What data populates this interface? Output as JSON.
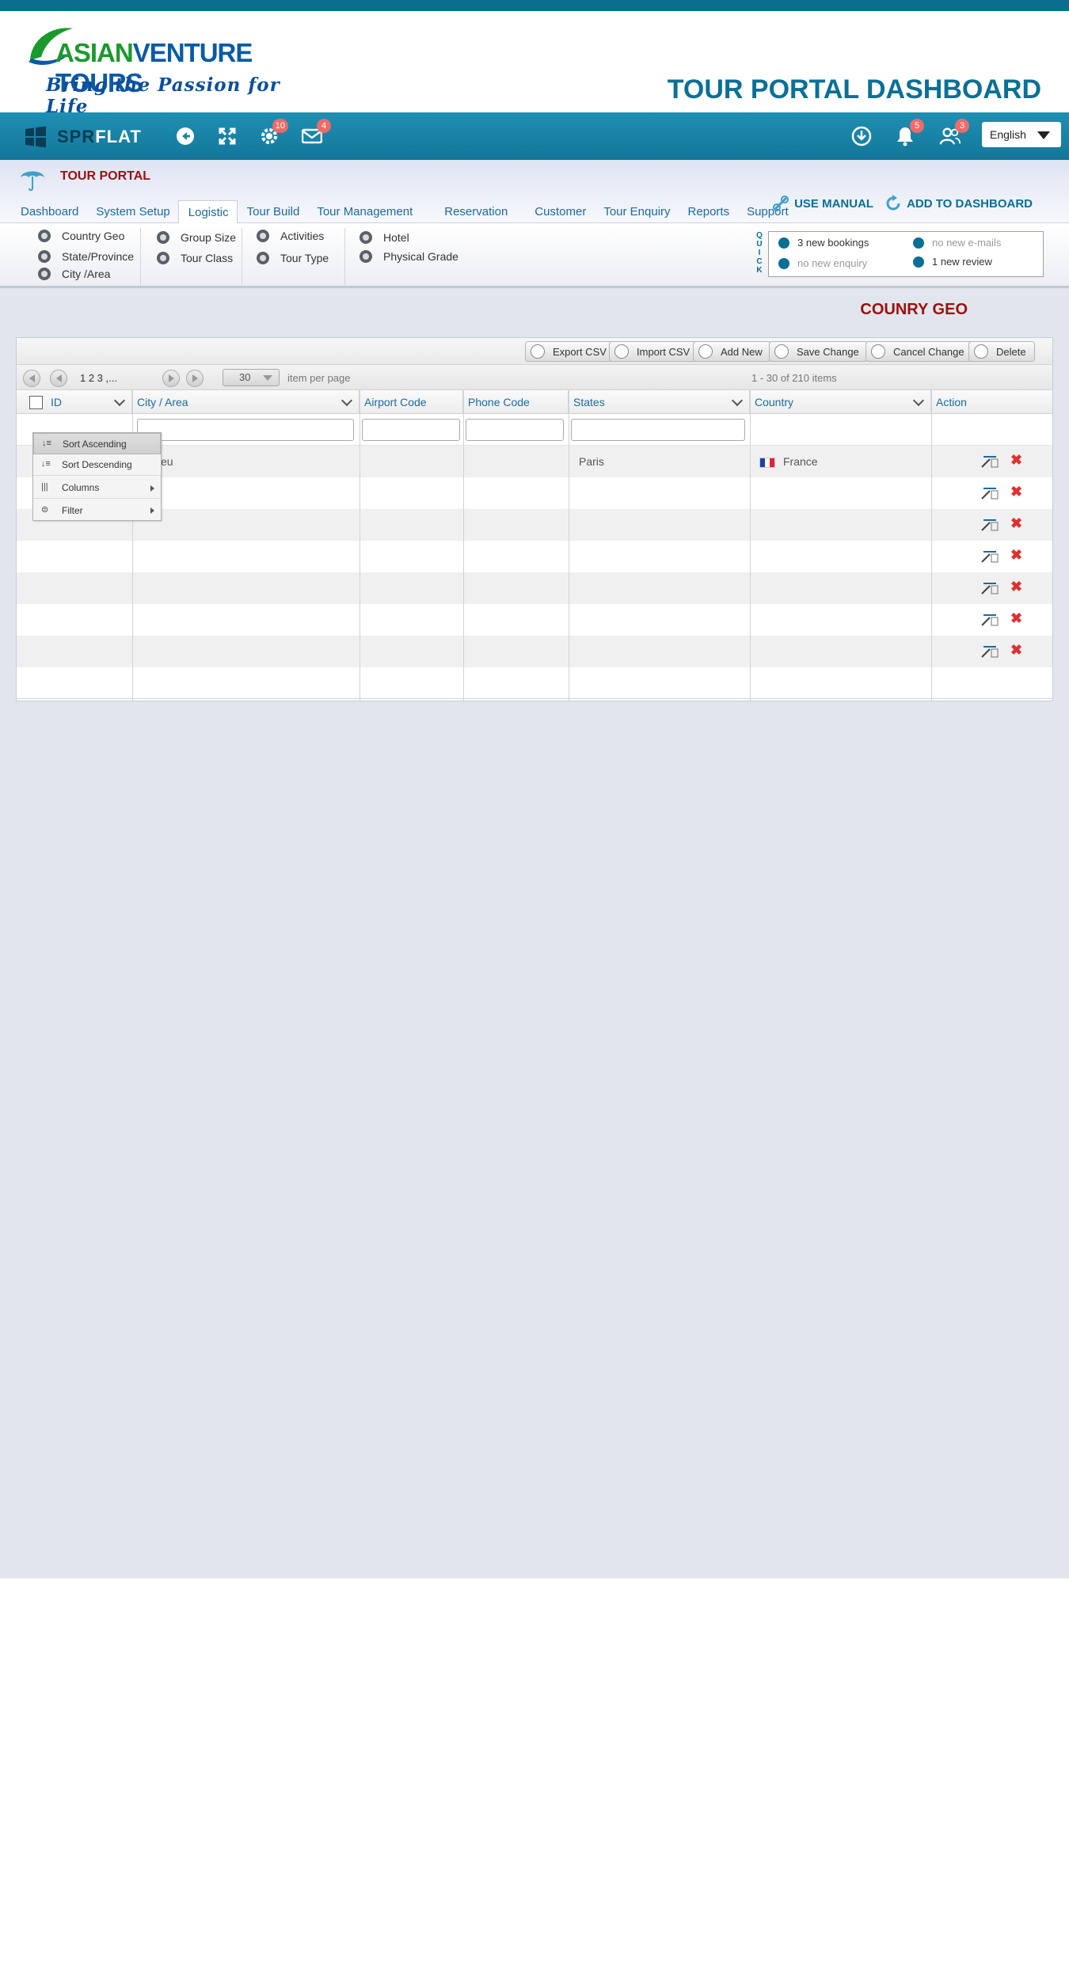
{
  "header": {
    "logo_word_part1": "ASIAN",
    "logo_word_part2": "VENTURE TOURS",
    "logo_tagline": "Bring the Passion for Life",
    "portal_title": "TOUR PORTAL DASHBOARD"
  },
  "toolbar": {
    "brand_dim": "SPR",
    "brand_bright": "FLAT",
    "settings_badge": "10",
    "mail_badge": "4",
    "notifications_badge": "5",
    "users_badge": "3",
    "language": "English"
  },
  "nav": {
    "section_title": "TOUR PORTAL",
    "tabs": [
      "Dashboard",
      "System Setup",
      "Logistic",
      "Tour Build",
      "Tour Management",
      "Reservation",
      "Customer",
      "Tour Enquiry",
      "Reports",
      "Support"
    ],
    "active_tab": "Logistic",
    "use_manual": "USE MANUAL",
    "add_to_dashboard": "ADD TO  DASHBOARD"
  },
  "submenu": {
    "col1": [
      "Country Geo",
      "State/Province",
      "City /Area"
    ],
    "col2": [
      "Group Size",
      "Tour Class"
    ],
    "col3": [
      "Activities",
      "Tour Type"
    ],
    "col4": [
      "Hotel",
      "Physical Grade"
    ]
  },
  "quick": {
    "label_letters": [
      "Q",
      "U",
      "I",
      "C",
      "K"
    ],
    "bookings": "3 new bookings",
    "emails": "no new e-mails",
    "enquiry": "no new enquiry",
    "review": "1 new review"
  },
  "main": {
    "section_title": "COUNRY GEO",
    "buttons": [
      "Export CSV",
      "Import CSV",
      "Add New",
      "Save Change",
      "Cancel Change",
      "Delete"
    ],
    "pager": {
      "pages": "1  2  3 ,...",
      "page_size": "30",
      "page_size_label": "item per page",
      "range": "1 - 30  of 210 items"
    },
    "columns": [
      "ID",
      "City / Area",
      "Airport Code",
      "Phone Code",
      "States",
      "Country",
      "Action"
    ],
    "rows": [
      {
        "city": "eu",
        "states": "Paris",
        "country": "France"
      },
      {
        "city": "",
        "states": "",
        "country": ""
      },
      {
        "city": "",
        "states": "",
        "country": ""
      },
      {
        "city": "",
        "states": "",
        "country": ""
      },
      {
        "city": "",
        "states": "",
        "country": ""
      },
      {
        "city": "",
        "states": "",
        "country": ""
      },
      {
        "city": "",
        "states": "",
        "country": ""
      }
    ],
    "context_menu": {
      "sort_ascending": "Sort Ascending",
      "sort_descending": "Sort Descending",
      "columns": "Columns",
      "filter": "Filter"
    }
  },
  "colors": {
    "brand_teal": "#0a7096",
    "accent_red": "#9b1010",
    "badge": "#f06a6a",
    "content_bg": "#e1e6ee"
  }
}
